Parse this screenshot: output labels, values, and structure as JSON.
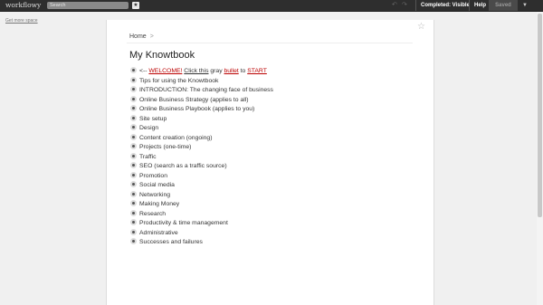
{
  "topbar": {
    "logo": "workflowy",
    "search_placeholder": "Search",
    "completed_label": "Completed: Visible",
    "help_label": "Help",
    "saved_label": "Saved",
    "undo_icon": "undo-arrow-icon",
    "redo_icon": "redo-arrow-icon"
  },
  "sidebar": {
    "more_space_link": "Get more space"
  },
  "breadcrumb": {
    "home": "Home",
    "separator": ">"
  },
  "page": {
    "title": "My Knowtbook",
    "welcome_item": {
      "prefix": "<-- ",
      "welcome": "WELCOME!",
      "click_this": "Click this",
      "gray": " gray ",
      "bullet": "bullet",
      "to": " to ",
      "start": "START"
    },
    "items": [
      "Tips for using the Knowtbook",
      "INTRODUCTION: The changing face of business",
      "Online Business Strategy (applies to all)",
      "Online Business Playbook (applies to you)",
      "Site setup",
      "Design",
      "Content creation (ongoing)",
      "Projects (one-time)",
      "Traffic",
      "SEO (search as a traffic source)",
      "Promotion",
      "Social media",
      "Networking",
      "Making Money",
      "Research",
      "Productivity & time management",
      "Administrative",
      "Successes and failures"
    ]
  },
  "colors": {
    "topbar_bg": "#2e2e2e",
    "page_bg": "#ffffff",
    "body_bg": "#f0f0f0",
    "link_red": "#b00000"
  }
}
